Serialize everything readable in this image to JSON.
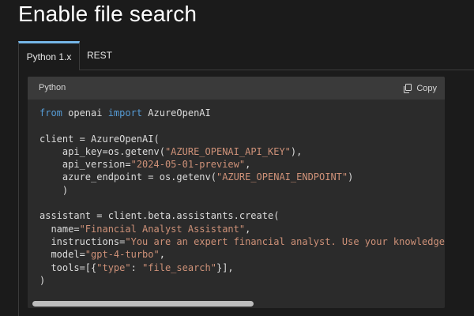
{
  "page": {
    "title": "Enable file search"
  },
  "tabs": [
    {
      "label": "Python 1.x",
      "selected": true
    },
    {
      "label": "REST",
      "selected": false
    }
  ],
  "code_block": {
    "language": "Python",
    "copy_label": "Copy",
    "copy_icon": "copy-icon",
    "lines": [
      [
        {
          "t": "from",
          "k": "kw"
        },
        {
          "t": " openai "
        },
        {
          "t": "import",
          "k": "kw"
        },
        {
          "t": " AzureOpenAI"
        }
      ],
      [],
      [
        {
          "t": "client = AzureOpenAI("
        }
      ],
      [
        {
          "t": "    api_key=os.getenv("
        },
        {
          "t": "\"AZURE_OPENAI_API_KEY\"",
          "k": "str"
        },
        {
          "t": "),"
        }
      ],
      [
        {
          "t": "    api_version="
        },
        {
          "t": "\"2024-05-01-preview\"",
          "k": "str"
        },
        {
          "t": ","
        }
      ],
      [
        {
          "t": "    azure_endpoint = os.getenv("
        },
        {
          "t": "\"AZURE_OPENAI_ENDPOINT\"",
          "k": "str"
        },
        {
          "t": ")"
        }
      ],
      [
        {
          "t": "    )"
        }
      ],
      [],
      [
        {
          "t": "assistant = client.beta.assistants.create("
        }
      ],
      [
        {
          "t": "  name="
        },
        {
          "t": "\"Financial Analyst Assistant\"",
          "k": "str"
        },
        {
          "t": ","
        }
      ],
      [
        {
          "t": "  instructions="
        },
        {
          "t": "\"You are an expert financial analyst. Use your knowledge b",
          "k": "str"
        }
      ],
      [
        {
          "t": "  model="
        },
        {
          "t": "\"gpt-4-turbo\"",
          "k": "str"
        },
        {
          "t": ","
        }
      ],
      [
        {
          "t": "  tools=[{"
        },
        {
          "t": "\"type\"",
          "k": "str"
        },
        {
          "t": ": "
        },
        {
          "t": "\"file_search\"",
          "k": "str"
        },
        {
          "t": "}],"
        }
      ],
      [
        {
          "t": ")"
        }
      ]
    ]
  },
  "colors": {
    "background": "#1b1b1b",
    "code_background": "#2b2b2b",
    "code_header": "#3a3a3a",
    "keyword": "#569cd6",
    "string": "#ce9178",
    "tab_accent": "#75b6e7"
  }
}
